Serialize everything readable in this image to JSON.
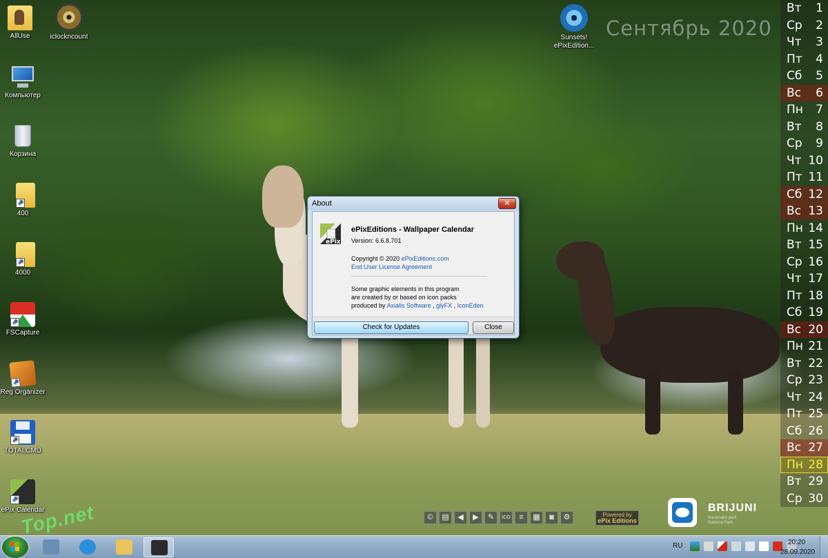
{
  "desktop": {
    "icons": [
      {
        "label": "AllUse",
        "icon": "user-folder-icon"
      },
      {
        "label": "iclockncount",
        "icon": "cd-disc-icon"
      },
      {
        "label": "Компьютер",
        "icon": "computer-icon"
      },
      {
        "label": "Корзина",
        "icon": "recycle-bin-icon"
      },
      {
        "label": "400",
        "icon": "folder-shortcut-icon"
      },
      {
        "label": "4000",
        "icon": "folder-shortcut-icon"
      },
      {
        "label": "FSCapture",
        "icon": "fscapture-icon"
      },
      {
        "label": "Reg Organizer",
        "icon": "reg-organizer-icon"
      },
      {
        "label": "TOTALCMD",
        "icon": "floppy-disk-icon"
      },
      {
        "label": "ePix Calendar",
        "icon": "epix-icon"
      },
      {
        "label": "Sunsets! ePixEdition...",
        "icon": "sunsets-disc-icon"
      }
    ]
  },
  "calendar": {
    "title": "Сентябрь 2020",
    "days": [
      {
        "dow": "Вт",
        "day": "1",
        "type": "weekday"
      },
      {
        "dow": "Ср",
        "day": "2",
        "type": "weekday"
      },
      {
        "dow": "Чт",
        "day": "3",
        "type": "weekday"
      },
      {
        "dow": "Пт",
        "day": "4",
        "type": "weekday"
      },
      {
        "dow": "Сб",
        "day": "5",
        "type": "weekday"
      },
      {
        "dow": "Вс",
        "day": "6",
        "type": "weekend"
      },
      {
        "dow": "Пн",
        "day": "7",
        "type": "weekday"
      },
      {
        "dow": "Вт",
        "day": "8",
        "type": "weekday"
      },
      {
        "dow": "Ср",
        "day": "9",
        "type": "weekday"
      },
      {
        "dow": "Чт",
        "day": "10",
        "type": "weekday"
      },
      {
        "dow": "Пт",
        "day": "11",
        "type": "weekday"
      },
      {
        "dow": "Сб",
        "day": "12",
        "type": "weekend"
      },
      {
        "dow": "Вс",
        "day": "13",
        "type": "weekend"
      },
      {
        "dow": "Пн",
        "day": "14",
        "type": "weekday"
      },
      {
        "dow": "Вт",
        "day": "15",
        "type": "weekday"
      },
      {
        "dow": "Ср",
        "day": "16",
        "type": "weekday"
      },
      {
        "dow": "Чт",
        "day": "17",
        "type": "weekday"
      },
      {
        "dow": "Пт",
        "day": "18",
        "type": "weekday"
      },
      {
        "dow": "Сб",
        "day": "19",
        "type": "weekday"
      },
      {
        "dow": "Вс",
        "day": "20",
        "type": "weekend"
      },
      {
        "dow": "Пн",
        "day": "21",
        "type": "weekday"
      },
      {
        "dow": "Вт",
        "day": "22",
        "type": "weekday"
      },
      {
        "dow": "Ср",
        "day": "23",
        "type": "weekday"
      },
      {
        "dow": "Чт",
        "day": "24",
        "type": "weekday"
      },
      {
        "dow": "Пт",
        "day": "25",
        "type": "weekday"
      },
      {
        "dow": "Сб",
        "day": "26",
        "type": "weekday"
      },
      {
        "dow": "Вс",
        "day": "27",
        "type": "weekend"
      },
      {
        "dow": "Пн",
        "day": "28",
        "type": "today"
      },
      {
        "dow": "Вт",
        "day": "29",
        "type": "weekday"
      },
      {
        "dow": "Ср",
        "day": "30",
        "type": "weekday"
      }
    ]
  },
  "about": {
    "window_title": "About",
    "close_glyph": "✕",
    "heading": "ePixEditions - Wallpaper Calendar",
    "version": "Version: 6.6.8.701",
    "copyright_prefix": "Copyright © 2020 ",
    "copyright_link": "ePixEditions.com",
    "eula_link": "End User License Agreement",
    "graphics_line1": "Some graphic elements in this program",
    "graphics_line2": "are created by or based on icon packs",
    "graphics_line3_prefix": "produced by ",
    "credit_axialis": "Axialis Software",
    "credit_sep1": " , ",
    "credit_glyfx": "glyFX",
    "credit_sep2": " , ",
    "credit_iconeden": "IconEden",
    "check_updates_label": "Check for Updates",
    "close_label": "Close"
  },
  "wallpaper_toolbar": {
    "buttons": [
      {
        "name": "copyright-icon",
        "glyph": "©"
      },
      {
        "name": "print-icon",
        "glyph": "▤"
      },
      {
        "name": "arrow-left-icon",
        "glyph": "◀"
      },
      {
        "name": "arrow-right-icon",
        "glyph": "▶"
      },
      {
        "name": "wrench-icon",
        "glyph": "✎"
      },
      {
        "name": "ico-icon",
        "glyph": "ICO"
      },
      {
        "name": "document-icon",
        "glyph": "≡"
      },
      {
        "name": "grid-icon",
        "glyph": "▦"
      },
      {
        "name": "camera-icon",
        "glyph": "◙"
      },
      {
        "name": "gear-icon",
        "glyph": "⚙"
      }
    ],
    "powered_line1": "Powered by",
    "powered_line2": "ePix Editions"
  },
  "brand": {
    "name": "BRIJUNI",
    "sub1": "Nacionalni park",
    "sub2": "National Park"
  },
  "watermark": "Top.net",
  "taskbar": {
    "items": [
      {
        "name": "taskbar-calculator",
        "icon": "calculator-icon",
        "color": "#6a8fb5",
        "active": false
      },
      {
        "name": "taskbar-internet-explorer",
        "icon": "internet-explorer-icon",
        "color": "#2a8fdc",
        "active": false
      },
      {
        "name": "taskbar-explorer",
        "icon": "folder-icon",
        "color": "#e9c45b",
        "active": false
      },
      {
        "name": "taskbar-epix-calendar",
        "icon": "epix-icon",
        "color": "#2b2b2b",
        "active": true
      }
    ],
    "language": "RU",
    "time": "20:20",
    "date": "28.09.2020"
  },
  "colors": {
    "weekend_bg": "#781414",
    "today_text": "#ffe84a",
    "link": "#1b59b8"
  }
}
